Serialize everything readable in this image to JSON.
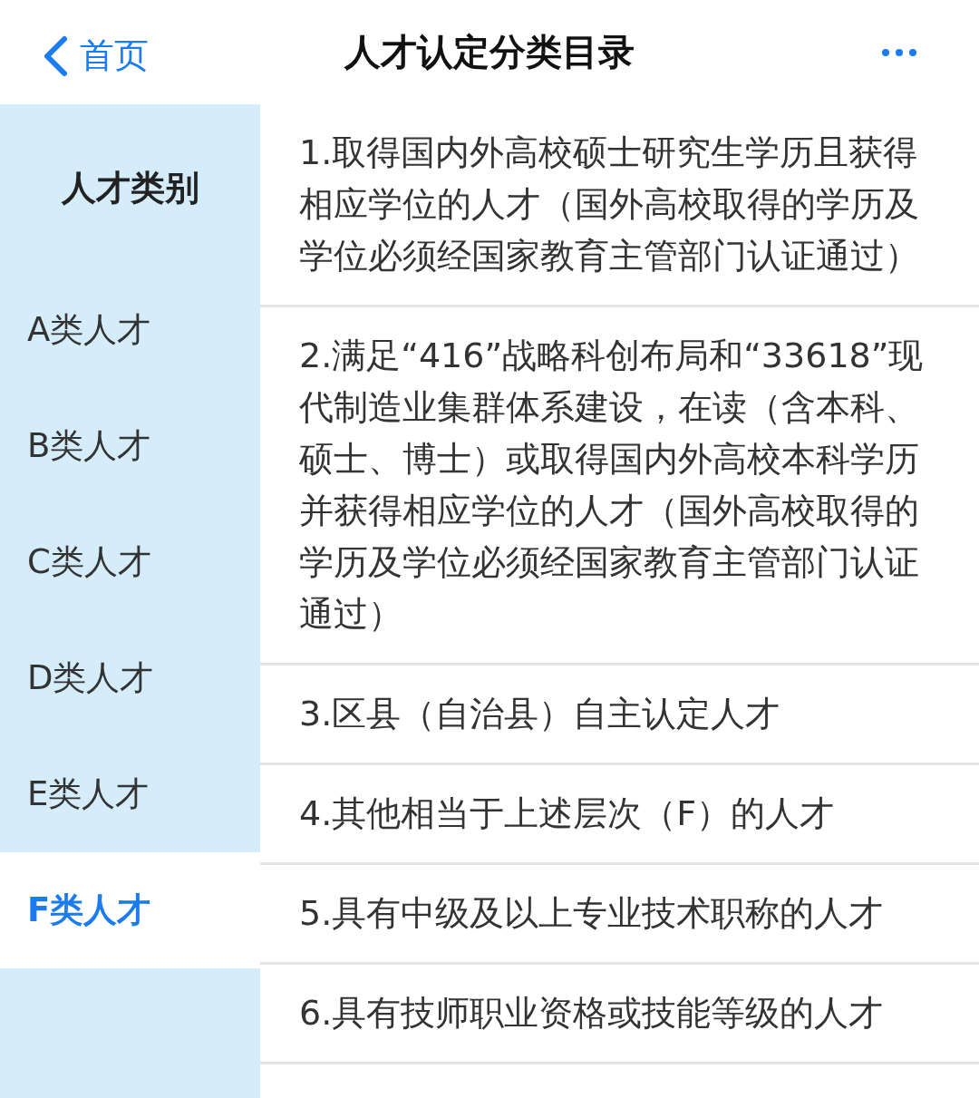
{
  "header": {
    "back_label": "首页",
    "title": "人才认定分类目录"
  },
  "sidebar": {
    "heading": "人才类别",
    "items": [
      {
        "label": "A类人才",
        "selected": false
      },
      {
        "label": "B类人才",
        "selected": false
      },
      {
        "label": "C类人才",
        "selected": false
      },
      {
        "label": "D类人才",
        "selected": false
      },
      {
        "label": "E类人才",
        "selected": false
      },
      {
        "label": "F类人才",
        "selected": true
      }
    ]
  },
  "list": [
    "1.取得国内外高校硕士研究生学历且获得相应学位的人才（国外高校取得的学历及学位必须经国家教育主管部门认证通过）",
    "2.满足“416”战略科创布局和“33618”现代制造业集群体系建设，在读（含本科、硕士、博士）或取得国内外高校本科学历并获得相应学位的人才（国外高校取得的学历及学位必须经国家教育主管部门认证通过）",
    "3.区县（自治县）自主认定人才",
    "4.其他相当于上述层次（F）的人才",
    "5.具有中级及以上专业技术职称的人才",
    "6.具有技师职业资格或技能等级的人才"
  ]
}
